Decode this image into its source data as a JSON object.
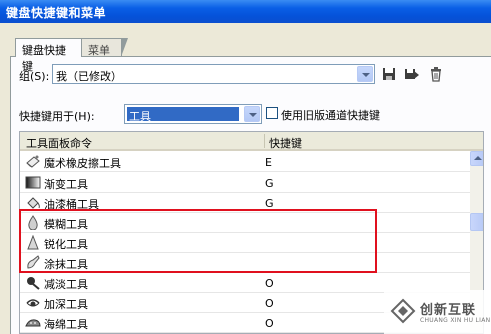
{
  "window": {
    "title": "键盘快捷键和菜单"
  },
  "tabs": [
    {
      "label": "键盘快捷键",
      "active": true
    },
    {
      "label": "菜单",
      "active": false
    }
  ],
  "set": {
    "label": "组(S):",
    "value": "我（已修改）"
  },
  "toolbar_icons": [
    "save-icon",
    "save-as-icon",
    "delete-icon"
  ],
  "shortcuts_for": {
    "label": "快捷键用于(H):",
    "value": "工具"
  },
  "legacy_channel_checkbox": {
    "label": "使用旧版通道快捷键",
    "checked": false
  },
  "table": {
    "columns": [
      "工具面板命令",
      "快捷键"
    ],
    "rows": [
      {
        "name": "魔术橡皮擦工具",
        "key": "E",
        "icon": "magic-eraser-icon"
      },
      {
        "name": "渐变工具",
        "key": "G",
        "icon": "gradient-icon"
      },
      {
        "name": "油漆桶工具",
        "key": "G",
        "icon": "paint-bucket-icon"
      },
      {
        "name": "模糊工具",
        "key": "",
        "icon": "blur-icon"
      },
      {
        "name": "锐化工具",
        "key": "",
        "icon": "sharpen-icon"
      },
      {
        "name": "涂抹工具",
        "key": "",
        "icon": "smudge-icon"
      },
      {
        "name": "减淡工具",
        "key": "O",
        "icon": "dodge-icon"
      },
      {
        "name": "加深工具",
        "key": "O",
        "icon": "burn-icon"
      },
      {
        "name": "海绵工具",
        "key": "O",
        "icon": "sponge-icon"
      }
    ]
  },
  "watermark": {
    "text": "创新互联",
    "subtext": "CHUANG XIN HU LIAN"
  },
  "colors": {
    "title_bar": "#0a5fe6",
    "highlight": "#e0101e",
    "selection": "#316ac5"
  }
}
